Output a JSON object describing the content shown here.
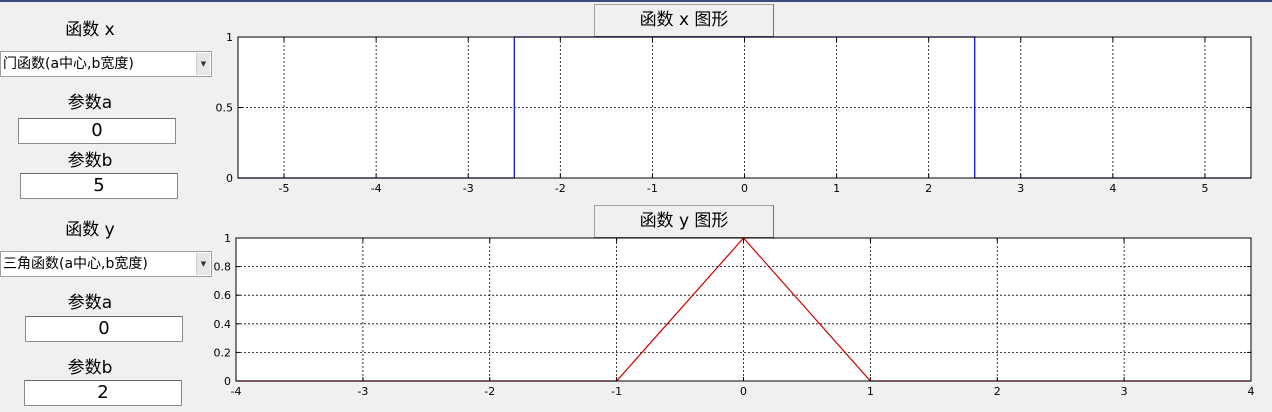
{
  "panel_x": {
    "label": "函数 x",
    "select_value": "门函数(a中心,b宽度)",
    "param_a_label": "参数a",
    "param_a_value": "0",
    "param_b_label": "参数b",
    "param_b_value": "5",
    "plot_title": "函数 x 图形"
  },
  "panel_y": {
    "label": "函数 y",
    "select_value": "三角函数(a中心,b宽度)",
    "param_a_label": "参数a",
    "param_a_value": "0",
    "param_b_label": "参数b",
    "param_b_value": "2",
    "plot_title": "函数 y 图形"
  },
  "chart_data": [
    {
      "type": "line",
      "xlim": [
        -5.5,
        5.5
      ],
      "ylim": [
        0,
        1
      ],
      "xticks": [
        -5,
        -4,
        -3,
        -2,
        -1,
        0,
        1,
        2,
        3,
        4,
        5
      ],
      "yticks": [
        0,
        0.5,
        1
      ],
      "grid": true,
      "color": "#0000cc",
      "x": [
        -5.5,
        -2.5,
        -2.5,
        2.5,
        2.5,
        5.5
      ],
      "y": [
        0,
        0,
        1,
        1,
        0,
        0
      ]
    },
    {
      "type": "line",
      "xlim": [
        -4,
        4
      ],
      "ylim": [
        0,
        1
      ],
      "xticks": [
        -4,
        -3,
        -2,
        -1,
        0,
        1,
        2,
        3,
        4
      ],
      "yticks": [
        0,
        0.2,
        0.4,
        0.6,
        0.8,
        1
      ],
      "grid": true,
      "color": "#cc0000",
      "x": [
        -4,
        -1,
        0,
        1,
        4
      ],
      "y": [
        0,
        0,
        1,
        0,
        0
      ]
    }
  ]
}
